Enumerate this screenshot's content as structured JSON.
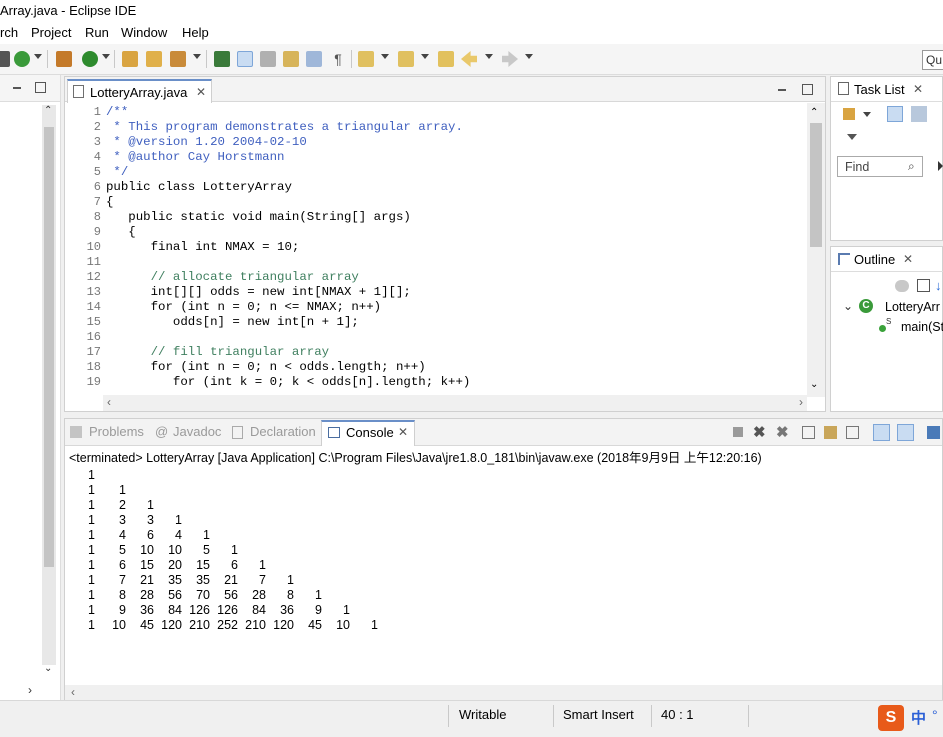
{
  "window": {
    "title": "Array.java - Eclipse IDE"
  },
  "menu": [
    "rch",
    "Project",
    "Run",
    "Window",
    "Help"
  ],
  "toolbar": {
    "quick_access": "Qu"
  },
  "editor": {
    "tab_label": "LotteryArray.java",
    "line_numbers": [
      "1",
      "2",
      "3",
      "4",
      "5",
      "6",
      "7",
      "8",
      "9",
      "10",
      "11",
      "12",
      "13",
      "14",
      "15",
      "16",
      "17",
      "18",
      "19"
    ],
    "code_lines": [
      "/**",
      " * This program demonstrates a triangular array.",
      " * @version 1.20 2004-02-10",
      " * @author Cay Horstmann",
      " */",
      "public class LotteryArray",
      "{",
      "   public static void main(String[] args)",
      "   {",
      "      final int NMAX = 10;",
      "",
      "      // allocate triangular array",
      "      int[][] odds = new int[NMAX + 1][];",
      "      for (int n = 0; n <= NMAX; n++)",
      "         odds[n] = new int[n + 1];",
      "",
      "      // fill triangular array",
      "      for (int n = 0; n < odds.length; n++)",
      "         for (int k = 0; k < odds[n].length; k++)"
    ]
  },
  "tasklist": {
    "title": "Task List",
    "find_placeholder": "Find"
  },
  "outline": {
    "title": "Outline",
    "class_item": "LotteryArr",
    "method_item": "main(St"
  },
  "console_tabs": {
    "problems": "Problems",
    "javadoc": "Javadoc",
    "declaration": "Declaration",
    "console": "Console"
  },
  "console": {
    "header": "<terminated> LotteryArray [Java Application] C:\\Program Files\\Java\\jre1.8.0_181\\bin\\javaw.exe (2018年9月9日 上午12:20:16)",
    "rows": [
      [
        "1"
      ],
      [
        "1",
        "1"
      ],
      [
        "1",
        "2",
        "1"
      ],
      [
        "1",
        "3",
        "3",
        "1"
      ],
      [
        "1",
        "4",
        "6",
        "4",
        "1"
      ],
      [
        "1",
        "5",
        "10",
        "10",
        "5",
        "1"
      ],
      [
        "1",
        "6",
        "15",
        "20",
        "15",
        "6",
        "1"
      ],
      [
        "1",
        "7",
        "21",
        "35",
        "35",
        "21",
        "7",
        "1"
      ],
      [
        "1",
        "8",
        "28",
        "56",
        "70",
        "56",
        "28",
        "8",
        "1"
      ],
      [
        "1",
        "9",
        "36",
        "84",
        "126",
        "126",
        "84",
        "36",
        "9",
        "1"
      ],
      [
        "1",
        "10",
        "45",
        "120",
        "210",
        "252",
        "210",
        "120",
        "45",
        "10",
        "1"
      ]
    ]
  },
  "status": {
    "writable": "Writable",
    "insert_mode": "Smart Insert",
    "position": "40 : 1",
    "ime": "中"
  }
}
